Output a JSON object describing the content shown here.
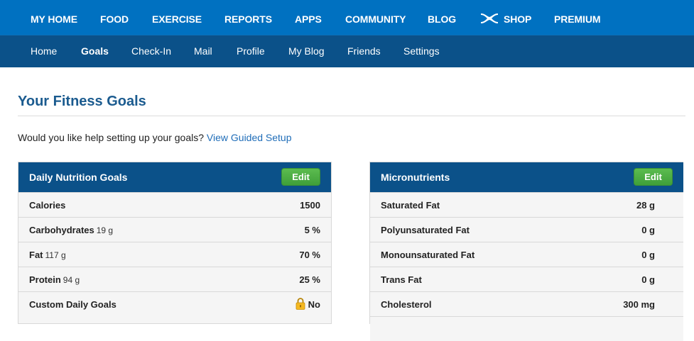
{
  "topnav": {
    "items": [
      "MY HOME",
      "FOOD",
      "EXERCISE",
      "REPORTS",
      "APPS",
      "COMMUNITY",
      "BLOG",
      "SHOP",
      "PREMIUM"
    ]
  },
  "subnav": {
    "items": [
      "Home",
      "Goals",
      "Check-In",
      "Mail",
      "Profile",
      "My Blog",
      "Friends",
      "Settings"
    ],
    "active": "Goals"
  },
  "page": {
    "title": "Your Fitness Goals",
    "help_text": "Would you like help setting up your goals?",
    "help_link": "View Guided Setup"
  },
  "nutrition": {
    "title": "Daily Nutrition Goals",
    "edit_label": "Edit",
    "rows": [
      {
        "label": "Calories",
        "sub": "",
        "value": "1500"
      },
      {
        "label": "Carbohydrates",
        "sub": "19 g",
        "value": "5 %"
      },
      {
        "label": "Fat",
        "sub": "117 g",
        "value": "70 %"
      },
      {
        "label": "Protein",
        "sub": "94 g",
        "value": "25 %"
      },
      {
        "label": "Custom Daily Goals",
        "sub": "",
        "value": "No"
      }
    ]
  },
  "micronutrients": {
    "title": "Micronutrients",
    "edit_label": "Edit",
    "rows": [
      {
        "label": "Saturated Fat",
        "value": "28 g"
      },
      {
        "label": "Polyunsaturated Fat",
        "value": "0 g"
      },
      {
        "label": "Monounsaturated Fat",
        "value": "0 g"
      },
      {
        "label": "Trans Fat",
        "value": "0 g"
      },
      {
        "label": "Cholesterol",
        "value": "300 mg"
      }
    ]
  },
  "colors": {
    "topnav_bg": "#0071c1",
    "subnav_bg": "#0b5189",
    "title_color": "#1b5b8f",
    "edit_green": "#4caf45",
    "link_color": "#1f6db8"
  },
  "icons": {
    "shop_logo": "under-armour-logo-icon",
    "lock": "padlock-icon"
  }
}
